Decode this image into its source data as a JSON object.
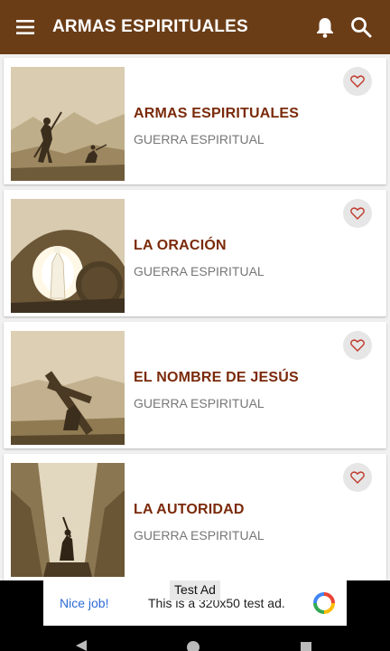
{
  "appbar": {
    "title": "ARMAS ESPIRITUALES",
    "menu_icon": "hamburger-icon",
    "bell_icon": "bell-icon",
    "search_icon": "search-icon"
  },
  "items": [
    {
      "title": "ARMAS ESPIRITUALES",
      "subtitle": "GUERRA ESPIRITUAL",
      "image": "david-goliath-illustration"
    },
    {
      "title": "LA ORACIÓN",
      "subtitle": "GUERRA ESPIRITUAL",
      "image": "resurrection-tomb-illustration"
    },
    {
      "title": "EL NOMBRE DE JESÚS",
      "subtitle": "GUERRA ESPIRITUAL",
      "image": "cross-bearing-illustration"
    },
    {
      "title": "LA AUTORIDAD",
      "subtitle": "GUERRA ESPIRITUAL",
      "image": "moses-staff-illustration"
    }
  ],
  "ad": {
    "label": "Test Ad",
    "nice": "Nice job!",
    "text": "This is a 320x50 test ad."
  },
  "colors": {
    "appbar": "#6b3d17",
    "title_text": "#7a2a0a",
    "heart": "#c0392b"
  }
}
